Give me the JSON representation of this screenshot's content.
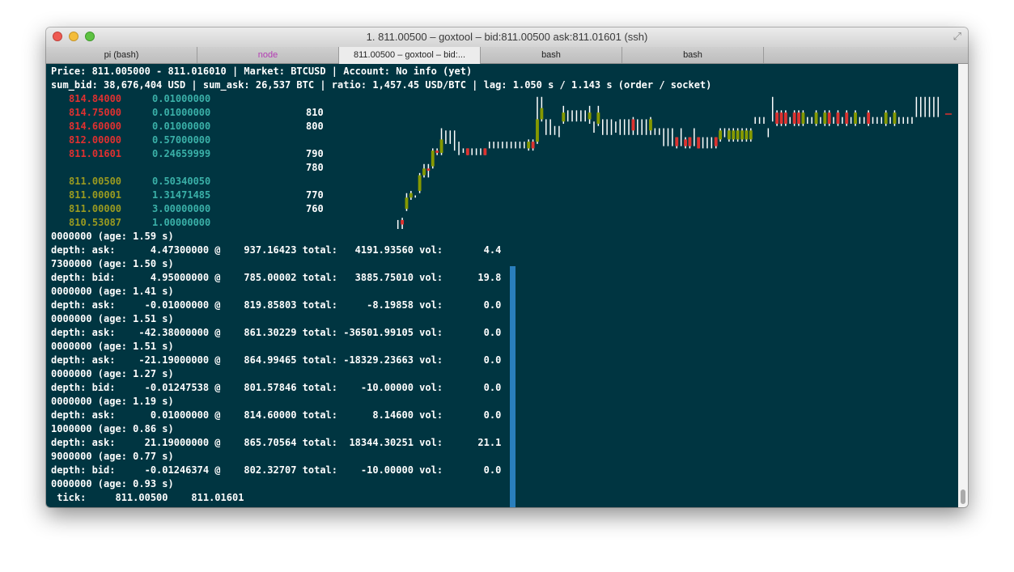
{
  "window": {
    "title": "1. 811.00500 – goxtool – bid:811.00500 ask:811.01601 (ssh)",
    "fullscreen_icon": "fullscreen-arrows-icon"
  },
  "tabs": [
    {
      "label": "pi (bash)"
    },
    {
      "label": "node"
    },
    {
      "label": "811.00500 – goxtool – bid:..."
    },
    {
      "label": "bash"
    },
    {
      "label": "bash"
    }
  ],
  "header": {
    "line1": "Price: 811.005000 - 811.016010 | Market: BTCUSD | Account: No info (yet)",
    "line2": "sum_bid: 38,676,404 USD | sum_ask: 26,537 BTC | ratio: 1,457.45 USD/BTC | lag: 1.050 s / 1.143 s (order / socket)"
  },
  "orderbook": {
    "asks": [
      {
        "price": "814.84000",
        "volume": "0.01000000"
      },
      {
        "price": "814.75000",
        "volume": "0.01000000"
      },
      {
        "price": "814.60000",
        "volume": "0.01000000"
      },
      {
        "price": "812.00000",
        "volume": "0.57000000"
      },
      {
        "price": "811.01601",
        "volume": "0.24659999"
      }
    ],
    "bids": [
      {
        "price": "811.00500",
        "volume": "0.50340050"
      },
      {
        "price": "811.00001",
        "volume": "1.31471485"
      },
      {
        "price": "811.00000",
        "volume": "3.00000000"
      },
      {
        "price": "810.53087",
        "volume": "1.00000000"
      }
    ]
  },
  "chart_data": {
    "type": "candlestick",
    "y_tick_labels": [
      "810",
      "800",
      "790",
      "780",
      "770",
      "760"
    ],
    "y_ticks": [
      810,
      800,
      790,
      780,
      770,
      760
    ],
    "ylim": [
      756,
      816
    ],
    "colors": {
      "up": "#859900",
      "down": "#dc322f",
      "wick": "#ffffff"
    },
    "candles": [
      {
        "open": 759,
        "close": 759,
        "high": 760,
        "low": 756
      },
      {
        "open": 760,
        "close": 758,
        "high": 761,
        "low": 756
      },
      {
        "open": 765,
        "close": 770,
        "high": 772,
        "low": 764
      },
      {
        "open": 770,
        "close": 772,
        "high": 773,
        "low": 769
      },
      {
        "open": 771,
        "close": 771,
        "high": 771,
        "low": 770
      },
      {
        "open": 773,
        "close": 780,
        "high": 781,
        "low": 772
      },
      {
        "open": 780,
        "close": 783,
        "high": 785,
        "low": 779
      },
      {
        "open": 783,
        "close": 782,
        "high": 785,
        "low": 779
      },
      {
        "open": 784,
        "close": 791,
        "high": 792,
        "low": 783
      },
      {
        "open": 791,
        "close": 790,
        "high": 792,
        "low": 789
      },
      {
        "open": 790,
        "close": 796,
        "high": 801,
        "low": 789
      },
      {
        "open": 795,
        "close": 795,
        "high": 800,
        "low": 794
      },
      {
        "open": 794,
        "close": 794,
        "high": 800,
        "low": 794
      },
      {
        "open": 795,
        "close": 795,
        "high": 800,
        "low": 791
      },
      {
        "open": 794,
        "close": 794,
        "high": 795,
        "low": 789
      },
      {
        "open": 792,
        "close": 792,
        "high": 792,
        "low": 790
      },
      {
        "open": 792,
        "close": 789,
        "high": 792,
        "low": 789
      },
      {
        "open": 790,
        "close": 790,
        "high": 792,
        "low": 789
      },
      {
        "open": 790,
        "close": 790,
        "high": 792,
        "low": 789
      },
      {
        "open": 790,
        "close": 790,
        "high": 792,
        "low": 789
      },
      {
        "open": 792,
        "close": 789,
        "high": 792,
        "low": 789
      },
      {
        "open": 793,
        "close": 793,
        "high": 795,
        "low": 792
      },
      {
        "open": 794,
        "close": 794,
        "high": 795,
        "low": 792
      },
      {
        "open": 794,
        "close": 794,
        "high": 795,
        "low": 792
      },
      {
        "open": 795,
        "close": 795,
        "high": 795,
        "low": 792
      },
      {
        "open": 795,
        "close": 795,
        "high": 795,
        "low": 792
      },
      {
        "open": 795,
        "close": 795,
        "high": 795,
        "low": 792
      },
      {
        "open": 794,
        "close": 794,
        "high": 795,
        "low": 792
      },
      {
        "open": 795,
        "close": 795,
        "high": 795,
        "low": 792
      },
      {
        "open": 792,
        "close": 792,
        "high": 795,
        "low": 792
      },
      {
        "open": 792,
        "close": 795,
        "high": 796,
        "low": 791
      },
      {
        "open": 795,
        "close": 792,
        "high": 796,
        "low": 791
      },
      {
        "open": 795,
        "close": 805,
        "high": 815,
        "low": 794
      },
      {
        "open": 805,
        "close": 810,
        "high": 815,
        "low": 804
      },
      {
        "open": 800,
        "close": 800,
        "high": 805,
        "low": 798
      },
      {
        "open": 800,
        "close": 800,
        "high": 805,
        "low": 798
      },
      {
        "open": 800,
        "close": 800,
        "high": 802,
        "low": 798
      },
      {
        "open": 798,
        "close": 798,
        "high": 802,
        "low": 797
      },
      {
        "open": 804,
        "close": 808,
        "high": 811,
        "low": 803
      },
      {
        "open": 808,
        "close": 808,
        "high": 809,
        "low": 804
      },
      {
        "open": 805,
        "close": 805,
        "high": 809,
        "low": 804
      },
      {
        "open": 805,
        "close": 805,
        "high": 809,
        "low": 804
      },
      {
        "open": 805,
        "close": 805,
        "high": 809,
        "low": 804
      },
      {
        "open": 805,
        "close": 805,
        "high": 809,
        "low": 804
      },
      {
        "open": 805,
        "close": 808,
        "high": 811,
        "low": 803
      },
      {
        "open": 803,
        "close": 803,
        "high": 804,
        "low": 799
      },
      {
        "open": 803,
        "close": 808,
        "high": 811,
        "low": 802
      },
      {
        "open": 800,
        "close": 800,
        "high": 805,
        "low": 798
      },
      {
        "open": 800,
        "close": 800,
        "high": 805,
        "low": 798
      },
      {
        "open": 800,
        "close": 800,
        "high": 805,
        "low": 798
      },
      {
        "open": 803,
        "close": 803,
        "high": 804,
        "low": 799
      },
      {
        "open": 800,
        "close": 800,
        "high": 805,
        "low": 798
      },
      {
        "open": 800,
        "close": 800,
        "high": 805,
        "low": 798
      },
      {
        "open": 800,
        "close": 800,
        "high": 805,
        "low": 798
      },
      {
        "open": 805,
        "close": 800,
        "high": 806,
        "low": 798
      },
      {
        "open": 800,
        "close": 800,
        "high": 805,
        "low": 798
      },
      {
        "open": 800,
        "close": 800,
        "high": 805,
        "low": 798
      },
      {
        "open": 800,
        "close": 800,
        "high": 805,
        "low": 798
      },
      {
        "open": 800,
        "close": 805,
        "high": 806,
        "low": 798
      },
      {
        "open": 800,
        "close": 800,
        "high": 801,
        "low": 798
      },
      {
        "open": 800,
        "close": 800,
        "high": 801,
        "low": 798
      },
      {
        "open": 796,
        "close": 796,
        "high": 801,
        "low": 793
      },
      {
        "open": 798,
        "close": 798,
        "high": 801,
        "low": 793
      },
      {
        "open": 800,
        "close": 800,
        "high": 801,
        "low": 793
      },
      {
        "open": 797,
        "close": 793,
        "high": 797,
        "low": 792
      },
      {
        "open": 796,
        "close": 796,
        "high": 801,
        "low": 793
      },
      {
        "open": 796,
        "close": 793,
        "high": 797,
        "low": 792
      },
      {
        "open": 797,
        "close": 793,
        "high": 797,
        "low": 792
      },
      {
        "open": 796,
        "close": 796,
        "high": 801,
        "low": 793
      },
      {
        "open": 797,
        "close": 792,
        "high": 797,
        "low": 792
      },
      {
        "open": 796,
        "close": 796,
        "high": 797,
        "low": 792
      },
      {
        "open": 796,
        "close": 796,
        "high": 797,
        "low": 792
      },
      {
        "open": 796,
        "close": 796,
        "high": 797,
        "low": 792
      },
      {
        "open": 797,
        "close": 793,
        "high": 797,
        "low": 792
      },
      {
        "open": 796,
        "close": 800,
        "high": 801,
        "low": 795
      },
      {
        "open": 800,
        "close": 800,
        "high": 801,
        "low": 797
      },
      {
        "open": 796,
        "close": 800,
        "high": 801,
        "low": 795
      },
      {
        "open": 796,
        "close": 800,
        "high": 801,
        "low": 795
      },
      {
        "open": 796,
        "close": 800,
        "high": 801,
        "low": 795
      },
      {
        "open": 796,
        "close": 800,
        "high": 801,
        "low": 795
      },
      {
        "open": 796,
        "close": 800,
        "high": 801,
        "low": 795
      },
      {
        "open": 796,
        "close": 800,
        "high": 801,
        "low": 795
      },
      {
        "open": 805,
        "close": 805,
        "high": 806,
        "low": 803
      },
      {
        "open": 805,
        "close": 805,
        "high": 806,
        "low": 803
      },
      {
        "open": 805,
        "close": 805,
        "high": 806,
        "low": 803
      },
      {
        "open": 800,
        "close": 800,
        "high": 801,
        "low": 797
      },
      {
        "open": 807,
        "close": 807,
        "high": 815,
        "low": 804
      },
      {
        "open": 808,
        "close": 803,
        "high": 809,
        "low": 802
      },
      {
        "open": 808,
        "close": 803,
        "high": 809,
        "low": 802
      },
      {
        "open": 808,
        "close": 803,
        "high": 809,
        "low": 802
      },
      {
        "open": 805,
        "close": 805,
        "high": 806,
        "low": 803
      },
      {
        "open": 808,
        "close": 803,
        "high": 809,
        "low": 802
      },
      {
        "open": 808,
        "close": 803,
        "high": 809,
        "low": 802
      },
      {
        "open": 803,
        "close": 808,
        "high": 809,
        "low": 802
      },
      {
        "open": 805,
        "close": 805,
        "high": 806,
        "low": 803
      },
      {
        "open": 805,
        "close": 805,
        "high": 806,
        "low": 803
      },
      {
        "open": 803,
        "close": 808,
        "high": 809,
        "low": 802
      },
      {
        "open": 805,
        "close": 805,
        "high": 806,
        "low": 803
      },
      {
        "open": 803,
        "close": 808,
        "high": 809,
        "low": 802
      },
      {
        "open": 808,
        "close": 803,
        "high": 809,
        "low": 802
      },
      {
        "open": 805,
        "close": 805,
        "high": 806,
        "low": 803
      },
      {
        "open": 808,
        "close": 803,
        "high": 809,
        "low": 802
      },
      {
        "open": 805,
        "close": 805,
        "high": 806,
        "low": 803
      },
      {
        "open": 808,
        "close": 803,
        "high": 809,
        "low": 802
      },
      {
        "open": 805,
        "close": 805,
        "high": 806,
        "low": 803
      },
      {
        "open": 803,
        "close": 808,
        "high": 809,
        "low": 802
      },
      {
        "open": 805,
        "close": 805,
        "high": 806,
        "low": 803
      },
      {
        "open": 805,
        "close": 805,
        "high": 806,
        "low": 803
      },
      {
        "open": 808,
        "close": 803,
        "high": 809,
        "low": 802
      },
      {
        "open": 805,
        "close": 805,
        "high": 806,
        "low": 803
      },
      {
        "open": 805,
        "close": 805,
        "high": 806,
        "low": 803
      },
      {
        "open": 805,
        "close": 805,
        "high": 806,
        "low": 803
      },
      {
        "open": 803,
        "close": 808,
        "high": 809,
        "low": 802
      },
      {
        "open": 805,
        "close": 805,
        "high": 806,
        "low": 803
      },
      {
        "open": 803,
        "close": 808,
        "high": 809,
        "low": 802
      },
      {
        "open": 805,
        "close": 805,
        "high": 806,
        "low": 803
      },
      {
        "open": 805,
        "close": 805,
        "high": 806,
        "low": 803
      },
      {
        "open": 805,
        "close": 805,
        "high": 806,
        "low": 803
      },
      {
        "open": 805,
        "close": 805,
        "high": 806,
        "low": 803
      },
      {
        "open": 807,
        "close": 807,
        "high": 815,
        "low": 806
      },
      {
        "open": 807,
        "close": 807,
        "high": 815,
        "low": 806
      },
      {
        "open": 807,
        "close": 807,
        "high": 815,
        "low": 806
      },
      {
        "open": 807,
        "close": 807,
        "high": 815,
        "low": 806
      },
      {
        "open": 807,
        "close": 807,
        "high": 815,
        "low": 806
      },
      {
        "open": 807,
        "close": 807,
        "high": 815,
        "low": 806
      }
    ]
  },
  "log": [
    {
      "text": "0000000 (age: 1.59 s)"
    },
    {
      "text": "depth: ask:      4.47300000 @    937.16423 total:   4191.93560 vol:       4.4"
    },
    {
      "text": "7300000 (age: 1.50 s)"
    },
    {
      "text": "depth: bid:      4.95000000 @    785.00002 total:   3885.75010 vol:      19.8"
    },
    {
      "text": "0000000 (age: 1.41 s)"
    },
    {
      "text": "depth: ask:     -0.01000000 @    819.85803 total:     -8.19858 vol:       0.0"
    },
    {
      "text": "0000000 (age: 1.51 s)"
    },
    {
      "text": "depth: ask:    -42.38000000 @    861.30229 total: -36501.99105 vol:       0.0"
    },
    {
      "text": "0000000 (age: 1.51 s)"
    },
    {
      "text": "depth: ask:    -21.19000000 @    864.99465 total: -18329.23663 vol:       0.0"
    },
    {
      "text": "0000000 (age: 1.27 s)"
    },
    {
      "text": "depth: bid:     -0.01247538 @    801.57846 total:    -10.00000 vol:       0.0"
    },
    {
      "text": "0000000 (age: 1.19 s)"
    },
    {
      "text": "depth: ask:      0.01000000 @    814.60000 total:      8.14600 vol:       0.0"
    },
    {
      "text": "1000000 (age: 0.86 s)"
    },
    {
      "text": "depth: ask:     21.19000000 @    865.70564 total:  18344.30251 vol:      21.1"
    },
    {
      "text": "9000000 (age: 0.77 s)"
    },
    {
      "text": "depth: bid:     -0.01246374 @    802.32707 total:    -10.00000 vol:       0.0"
    },
    {
      "text": "0000000 (age: 0.93 s)"
    },
    {
      "text": " tick:     811.00500    811.01601"
    }
  ],
  "colors": {
    "terminal_bg": "#003541",
    "ask": "#e03030",
    "bid": "#9a9a20",
    "volume": "#3ab0a8",
    "divider": "#2a7fbd"
  }
}
